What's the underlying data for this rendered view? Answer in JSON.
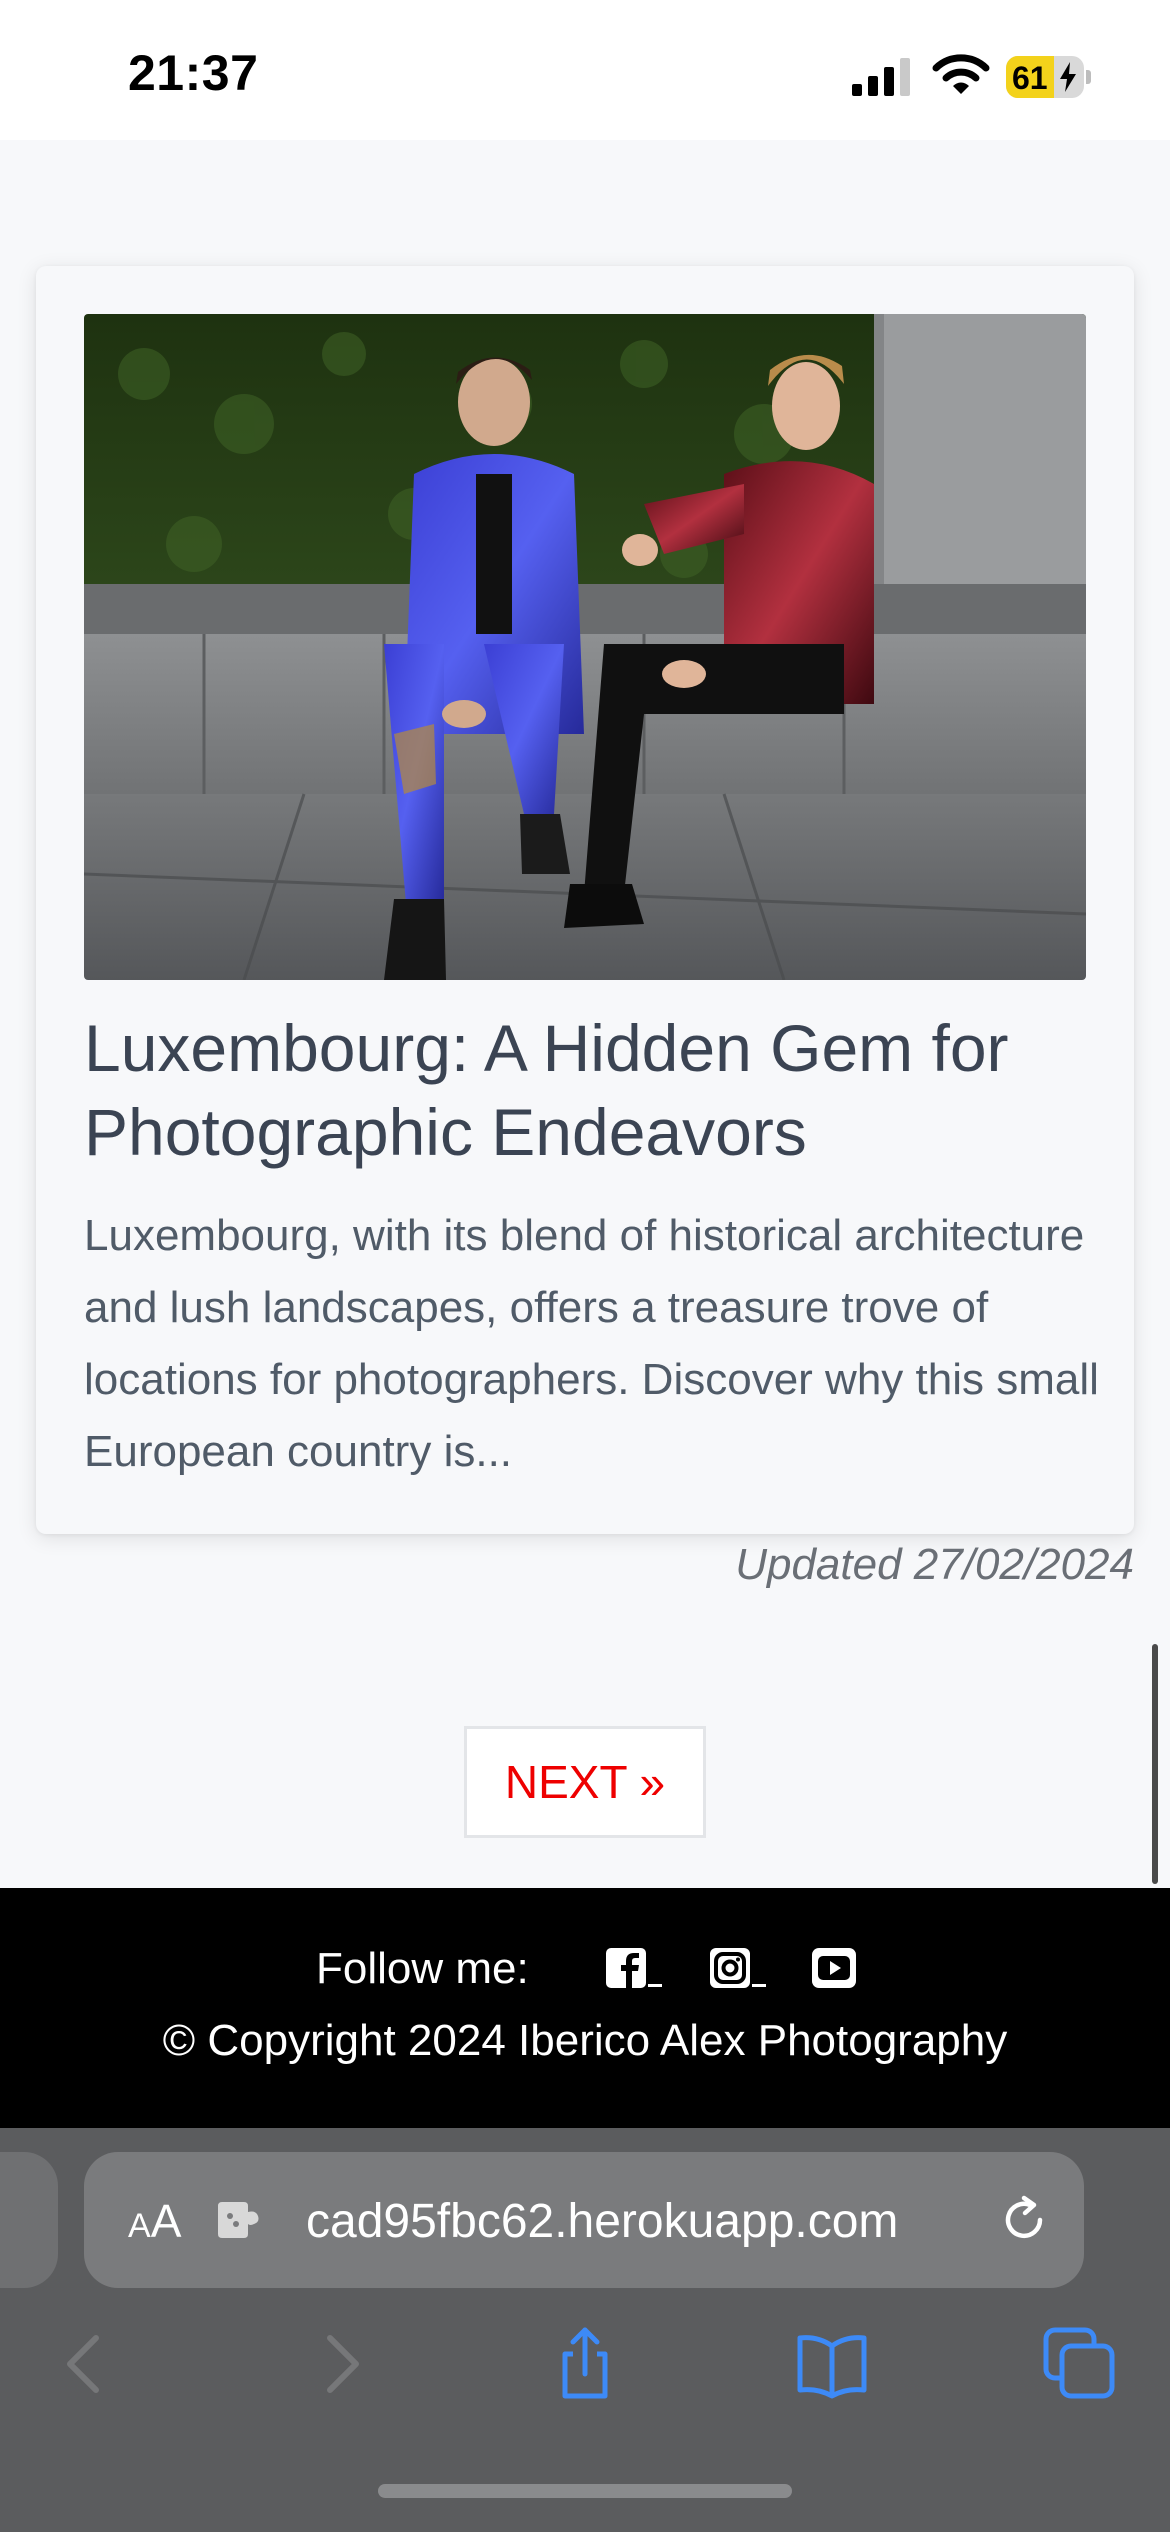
{
  "status_bar": {
    "time": "21:37",
    "battery_level": "61",
    "icons": [
      "signal-icon",
      "wifi-icon",
      "battery-charging-icon"
    ]
  },
  "post": {
    "title": "Luxembourg: A Hidden Gem for Photographic Endeavors",
    "excerpt": "Luxembourg, with its blend of historical architecture and lush landscapes, offers a treasure trove of locations for photographers. Discover why this small European country is...",
    "updated": "Updated 27/02/2024",
    "image_icon": "fashion-photo"
  },
  "pagination": {
    "next_label": "NEXT »"
  },
  "footer": {
    "follow_label": "Follow me:",
    "social_icons": [
      "facebook-icon",
      "instagram-icon",
      "youtube-icon"
    ],
    "copyright": "© Copyright 2024 Iberico Alex Photography"
  },
  "browser": {
    "aa_label_small": "A",
    "aa_label_large": "A",
    "url": "cad95fbc62.herokuapp.com",
    "toolbar_icons": [
      "back-icon",
      "forward-icon",
      "share-icon",
      "bookmarks-icon",
      "tabs-icon"
    ]
  },
  "colors": {
    "accent_next": "#ee0000",
    "battery_fill": "#f3d21b",
    "safari_blue": "#3d8af7",
    "footer_bg": "#000000"
  }
}
